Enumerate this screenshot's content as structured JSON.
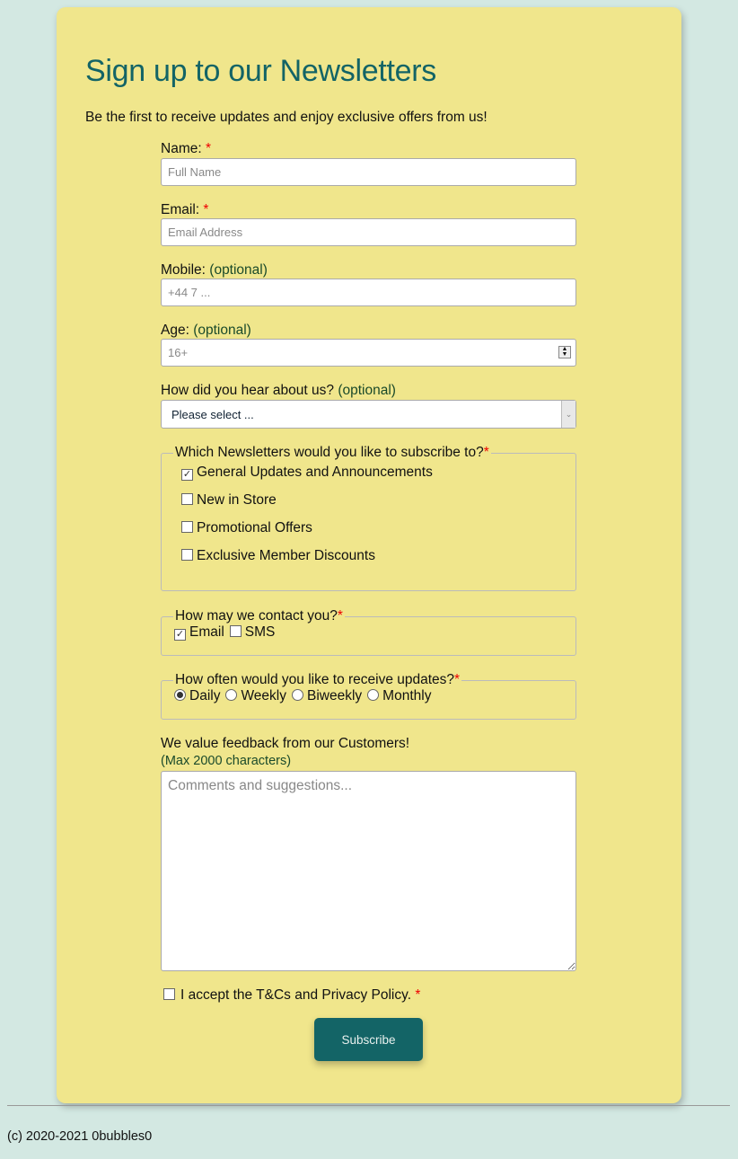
{
  "title": "Sign up to our Newsletters",
  "intro": "Be the first to receive updates and enjoy exclusive offers from us!",
  "required_mark": "*",
  "optional": "(optional)",
  "name": {
    "label": "Name:",
    "placeholder": "Full Name"
  },
  "email": {
    "label": "Email:",
    "placeholder": "Email Address"
  },
  "mobile": {
    "label": "Mobile:",
    "placeholder": "+44 7 ..."
  },
  "age": {
    "label": "Age:",
    "placeholder": "16+"
  },
  "source": {
    "label": "How did you hear about us?",
    "selected": "Please select ..."
  },
  "newsletters": {
    "legend": "Which Newsletters would you like to subscribe to?",
    "options": [
      {
        "label": "General Updates and Announcements",
        "checked": true
      },
      {
        "label": "New in Store",
        "checked": false
      },
      {
        "label": "Promotional Offers",
        "checked": false
      },
      {
        "label": "Exclusive Member Discounts",
        "checked": false
      }
    ]
  },
  "contact": {
    "legend": "How may we contact you?",
    "options": [
      {
        "label": "Email",
        "checked": true
      },
      {
        "label": "SMS",
        "checked": false
      }
    ]
  },
  "frequency": {
    "legend": "How often would you like to receive updates?",
    "options": [
      {
        "label": "Daily",
        "selected": true
      },
      {
        "label": "Weekly",
        "selected": false
      },
      {
        "label": "Biweekly",
        "selected": false
      },
      {
        "label": "Monthly",
        "selected": false
      }
    ]
  },
  "feedback": {
    "label": "We value feedback from our Customers!",
    "hint": "(Max 2000 characters)",
    "placeholder": "Comments and suggestions..."
  },
  "terms": {
    "label": "I accept the T&Cs and Privacy Policy.",
    "checked": false
  },
  "submit": "Subscribe",
  "footer": "(c) 2020-2021 0bubbles0",
  "colors": {
    "background": "#d3e8e2",
    "card": "#f0e68c",
    "accent": "#136466",
    "required": "#ee0000"
  }
}
